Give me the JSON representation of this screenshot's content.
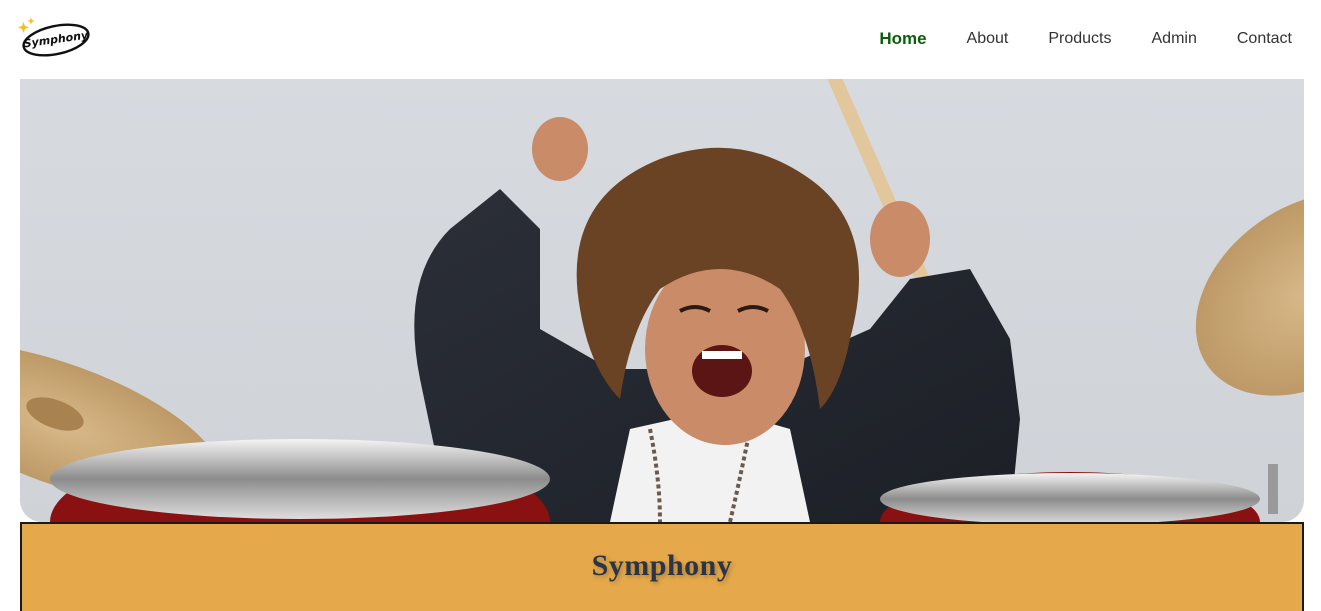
{
  "brand": {
    "logo_text": "Symphony"
  },
  "nav": {
    "items": [
      {
        "label": "Home",
        "active": true
      },
      {
        "label": "About",
        "active": false
      },
      {
        "label": "Products",
        "active": false
      },
      {
        "label": "Admin",
        "active": false
      },
      {
        "label": "Contact",
        "active": false
      }
    ]
  },
  "hero": {
    "image": "child-playing-drums-photo"
  },
  "banner": {
    "title": "Symphony"
  },
  "colors": {
    "nav_active": "#0b5f0b",
    "nav_text": "#333333",
    "banner_bg": "#e5a94b",
    "banner_text": "#2c3548"
  }
}
